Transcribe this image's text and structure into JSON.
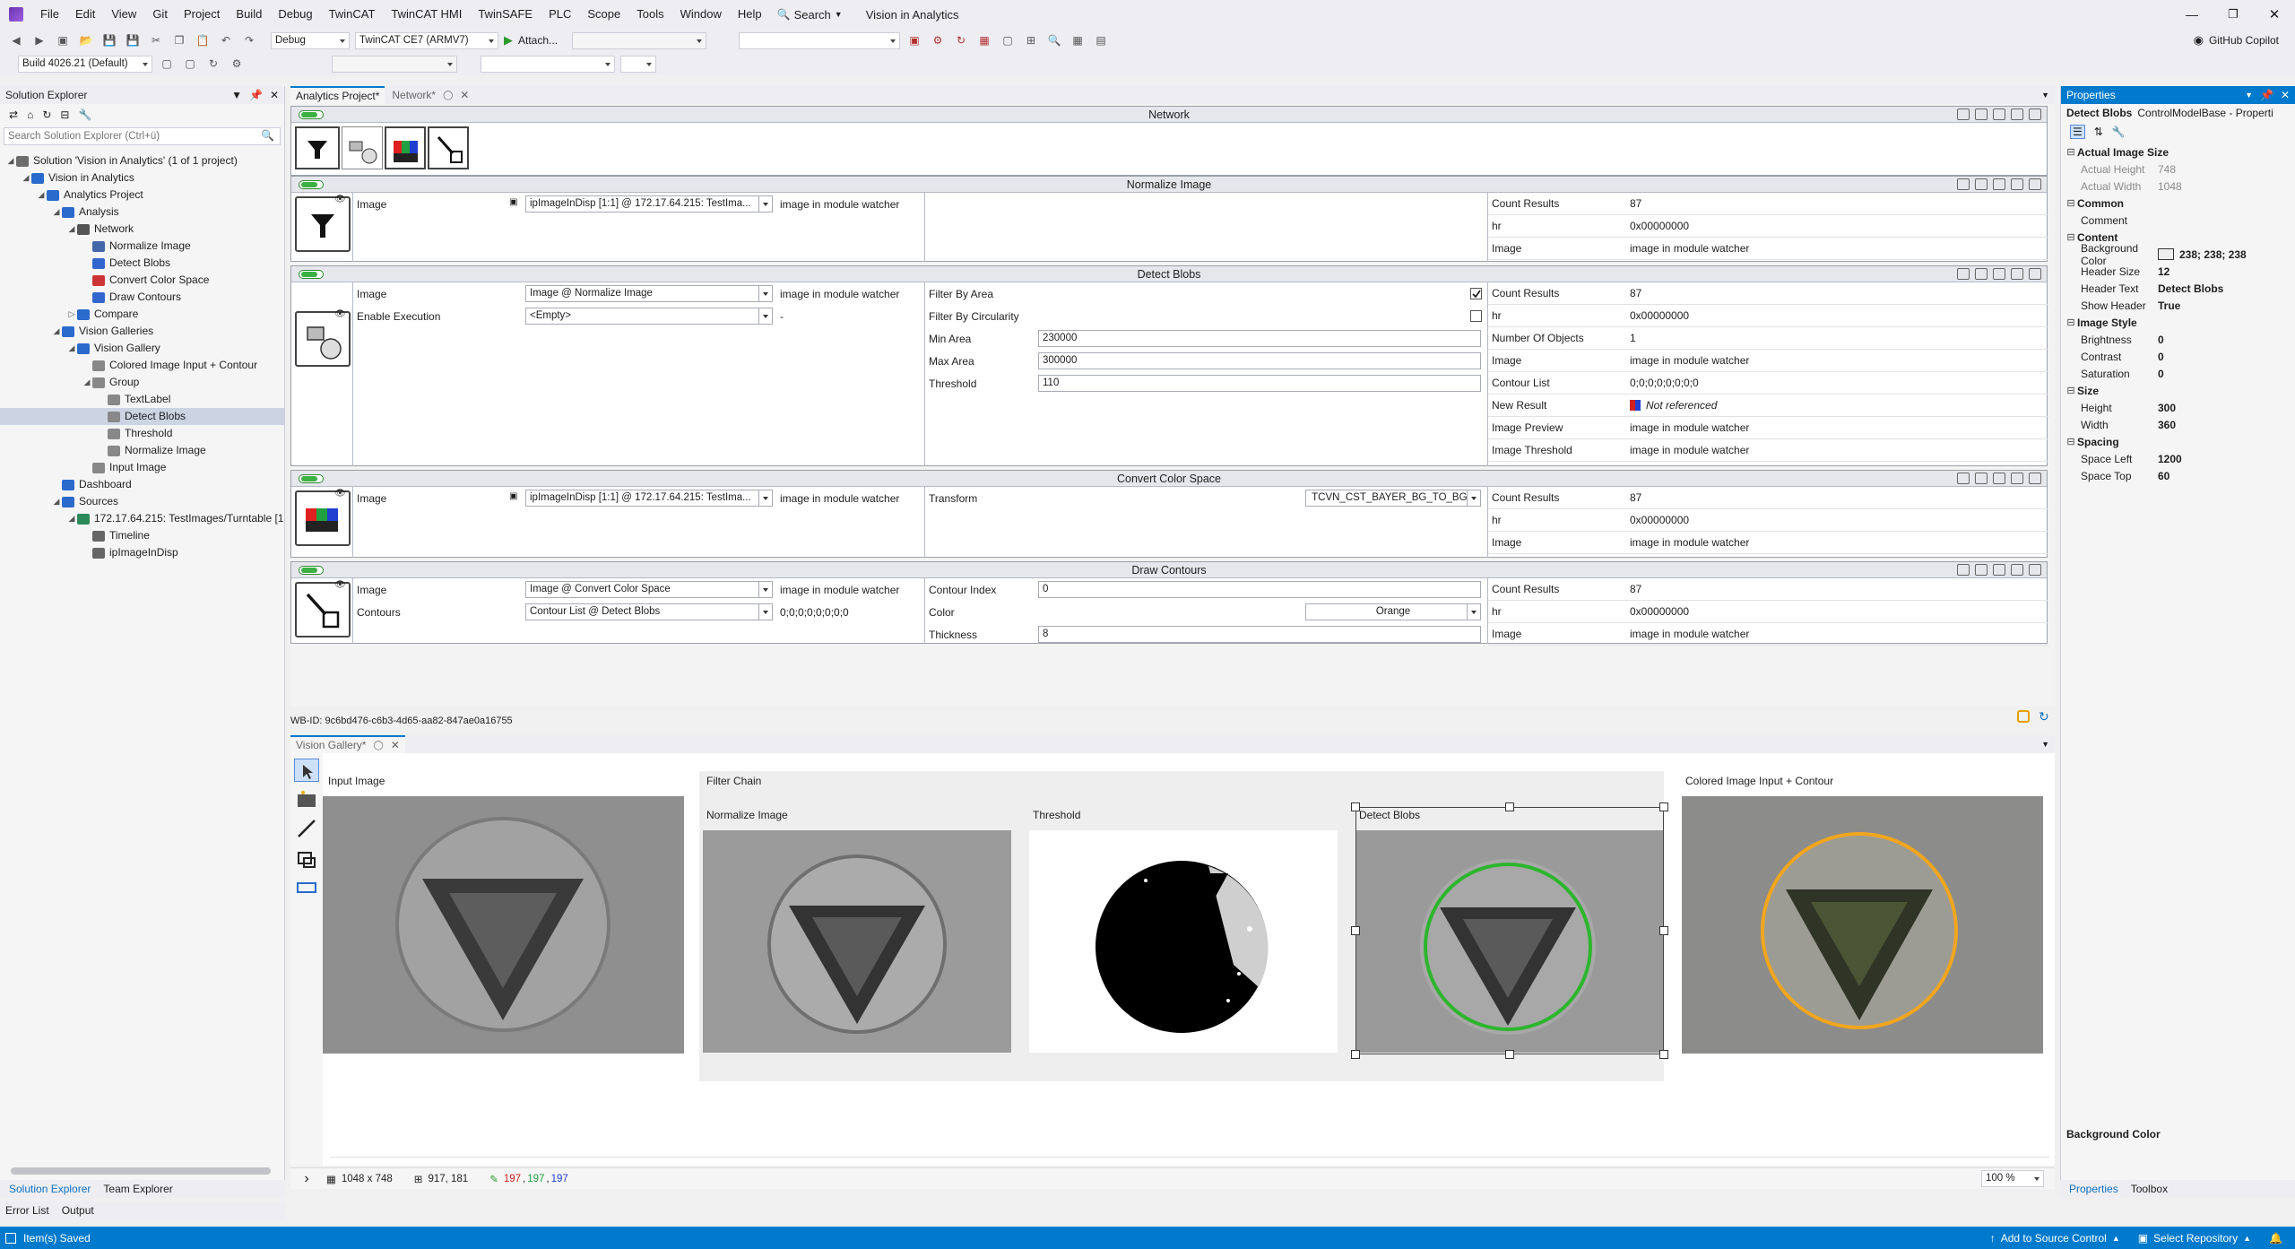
{
  "app": {
    "title": "Vision in Analytics",
    "menu": [
      "File",
      "Edit",
      "View",
      "Git",
      "Project",
      "Build",
      "Debug",
      "TwinCAT",
      "TwinCAT HMI",
      "TwinSAFE",
      "PLC",
      "Scope",
      "Tools",
      "Window",
      "Help"
    ],
    "search_label": "Search",
    "copilot_label": "GitHub Copilot"
  },
  "toolbar": {
    "config": "Debug",
    "platform": "TwinCAT CE7 (ARMV7)",
    "attach_label": "Attach...",
    "build": "Build 4026.21 (Default)"
  },
  "solution_explorer": {
    "title": "Solution Explorer",
    "search_placeholder": "Search Solution Explorer (Ctrl+ü)",
    "items": [
      {
        "label": "Solution 'Vision in Analytics' (1 of 1 project)",
        "depth": 0
      },
      {
        "label": "Vision in Analytics",
        "depth": 1
      },
      {
        "label": "Analytics Project",
        "depth": 2
      },
      {
        "label": "Analysis",
        "depth": 3
      },
      {
        "label": "Network",
        "depth": 4
      },
      {
        "label": "Normalize Image",
        "depth": 5
      },
      {
        "label": "Detect Blobs",
        "depth": 5
      },
      {
        "label": "Convert Color Space",
        "depth": 5
      },
      {
        "label": "Draw Contours",
        "depth": 5
      },
      {
        "label": "Compare",
        "depth": 4
      },
      {
        "label": "Vision Galleries",
        "depth": 3
      },
      {
        "label": "Vision Gallery",
        "depth": 4
      },
      {
        "label": "Colored Image Input + Contour",
        "depth": 5
      },
      {
        "label": "Group",
        "depth": 5
      },
      {
        "label": "TextLabel",
        "depth": 6
      },
      {
        "label": "Detect Blobs",
        "depth": 6,
        "selected": true
      },
      {
        "label": "Threshold",
        "depth": 6
      },
      {
        "label": "Normalize Image",
        "depth": 6
      },
      {
        "label": "Input Image",
        "depth": 5
      },
      {
        "label": "Dashboard",
        "depth": 3
      },
      {
        "label": "Sources",
        "depth": 3
      },
      {
        "label": "172.17.64.215: TestImages/Turntable [1",
        "depth": 4
      },
      {
        "label": "Timeline",
        "depth": 5
      },
      {
        "label": "ipImageInDisp",
        "depth": 5
      }
    ],
    "bottom_tabs": [
      "Solution Explorer",
      "Team Explorer"
    ],
    "bottom_tabs2": [
      "Error List",
      "Output"
    ]
  },
  "editor": {
    "tabs": [
      "Analytics Project*",
      "Network*"
    ],
    "network_title": "Network",
    "modules": [
      {
        "title": "Normalize Image",
        "inputs": [
          {
            "label": "Image",
            "value": "ipImageInDisp [1:1] @ 172.17.64.215: TestIma...",
            "note": "image in module watcher"
          }
        ],
        "params": [],
        "outputs": [
          {
            "label": "Count Results",
            "value": "87"
          },
          {
            "label": "hr",
            "value": "0x00000000"
          },
          {
            "label": "Image",
            "value": "image in module watcher"
          }
        ]
      },
      {
        "title": "Detect Blobs",
        "inputs": [
          {
            "label": "Image",
            "value": "Image @ Normalize Image",
            "note": "image in module watcher"
          },
          {
            "label": "Enable Execution",
            "value": "<Empty>",
            "note": "-"
          }
        ],
        "params": [
          {
            "label": "Filter By Area",
            "value": "",
            "check": true
          },
          {
            "label": "Filter By Circularity",
            "value": "",
            "check": false
          },
          {
            "label": "Min Area",
            "value": "230000"
          },
          {
            "label": "Max Area",
            "value": "300000"
          },
          {
            "label": "Threshold",
            "value": "110"
          }
        ],
        "outputs": [
          {
            "label": "Count Results",
            "value": "87"
          },
          {
            "label": "hr",
            "value": "0x00000000"
          },
          {
            "label": "Number Of Objects",
            "value": "1"
          },
          {
            "label": "Image",
            "value": "image in module watcher"
          },
          {
            "label": "Contour List",
            "value": "0;0;0;0;0;0;0;0"
          },
          {
            "label": "New Result",
            "value": "Not referenced"
          },
          {
            "label": "Image Preview",
            "value": "image in module watcher"
          },
          {
            "label": "Image Threshold",
            "value": "image in module watcher"
          }
        ]
      },
      {
        "title": "Convert Color Space",
        "inputs": [
          {
            "label": "Image",
            "value": "ipImageInDisp [1:1] @ 172.17.64.215: TestIma...",
            "note": "image in module watcher"
          }
        ],
        "params": [
          {
            "label": "Transform",
            "value": "TCVN_CST_BAYER_BG_TO_BGR"
          }
        ],
        "outputs": [
          {
            "label": "Count Results",
            "value": "87"
          },
          {
            "label": "hr",
            "value": "0x00000000"
          },
          {
            "label": "Image",
            "value": "image in module watcher"
          }
        ]
      },
      {
        "title": "Draw Contours",
        "inputs": [
          {
            "label": "Image",
            "value": "Image @ Convert Color Space",
            "note": "image in module watcher"
          },
          {
            "label": "Contours",
            "value": "Contour List @ Detect Blobs",
            "note": "0;0;0;0;0;0;0;0"
          }
        ],
        "params": [
          {
            "label": "Contour Index",
            "value": "0"
          },
          {
            "label": "Color",
            "value": "Orange"
          },
          {
            "label": "Thickness",
            "value": "8"
          }
        ],
        "outputs": [
          {
            "label": "Count Results",
            "value": "87"
          },
          {
            "label": "hr",
            "value": "0x00000000"
          },
          {
            "label": "Image",
            "value": "image in module watcher"
          }
        ]
      }
    ],
    "wb_id": "WB-ID: 9c6bd476-c6b3-4d65-aa82-847ae0a16755"
  },
  "gallery": {
    "tab": "Vision Gallery*",
    "tiles": {
      "input": "Input Image",
      "filter_chain": "Filter Chain",
      "normalize": "Normalize Image",
      "threshold": "Threshold",
      "detect": "Detect Blobs",
      "colored": "Colored Image Input + Contour"
    },
    "status": {
      "size": "1048 x 748",
      "pos": "917, 181",
      "r": "197",
      "g": "197",
      "b": "197",
      "zoom": "100 %"
    }
  },
  "properties": {
    "title": "Properties",
    "object": "Detect Blobs",
    "object_type": "ControlModelBase - Properti",
    "categories": [
      {
        "name": "Actual Image Size",
        "rows": [
          {
            "n": "Actual Height",
            "v": "748",
            "ro": true
          },
          {
            "n": "Actual Width",
            "v": "1048",
            "ro": true
          }
        ]
      },
      {
        "name": "Common",
        "rows": [
          {
            "n": "Comment",
            "v": ""
          }
        ]
      },
      {
        "name": "Content",
        "rows": [
          {
            "n": "Background Color",
            "v": "238; 238; 238",
            "swatch": true
          },
          {
            "n": "Header Size",
            "v": "12"
          },
          {
            "n": "Header Text",
            "v": "Detect Blobs"
          },
          {
            "n": "Show Header",
            "v": "True"
          }
        ]
      },
      {
        "name": "Image Style",
        "rows": [
          {
            "n": "Brightness",
            "v": "0"
          },
          {
            "n": "Contrast",
            "v": "0"
          },
          {
            "n": "Saturation",
            "v": "0"
          }
        ]
      },
      {
        "name": "Size",
        "rows": [
          {
            "n": "Height",
            "v": "300"
          },
          {
            "n": "Width",
            "v": "360"
          }
        ]
      },
      {
        "name": "Spacing",
        "rows": [
          {
            "n": "Space Left",
            "v": "1200"
          },
          {
            "n": "Space Top",
            "v": "60"
          }
        ]
      }
    ],
    "description_title": "Background Color",
    "bottom_tabs": [
      "Properties",
      "Toolbox"
    ]
  },
  "statusbar": {
    "left": "Item(s) Saved",
    "source_control": "Add to Source Control",
    "repository": "Select Repository"
  },
  "colors": {
    "accent": "#007acc",
    "contour_green": "#2db52d",
    "contour_orange": "#f2a61e"
  }
}
